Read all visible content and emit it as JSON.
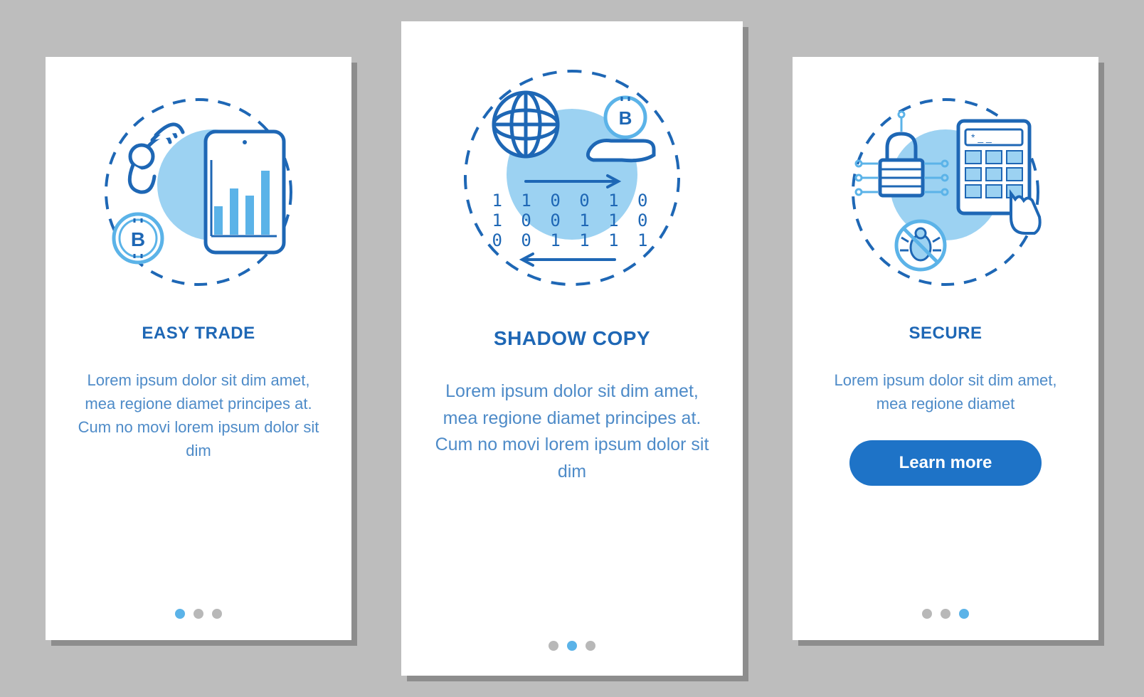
{
  "cards": [
    {
      "title": "Easy trade",
      "body": "Lorem ipsum dolor sit dim amet, mea regione diamet principes at. Cum no movi lorem ipsum dolor sit dim",
      "active_dot": 0,
      "cta": null
    },
    {
      "title": "Shadow copy",
      "body": "Lorem ipsum dolor sit dim amet, mea regione diamet principes at. Cum no movi lorem ipsum dolor sit dim",
      "active_dot": 1,
      "cta": null
    },
    {
      "title": "Secure",
      "body": "Lorem ipsum dolor sit dim amet, mea regione diamet",
      "active_dot": 2,
      "cta": "Learn more"
    }
  ],
  "colors": {
    "accent": "#1E73C7",
    "text_title": "#1E67B5",
    "text_body": "#4E8BC8",
    "dot_on": "#5BB3E8",
    "dot_off": "#B8B8B8"
  },
  "illustrations": {
    "binary_rows": [
      "1 1 0 0 1 0",
      "1 0 0 1 1 0",
      "0 0 1 1 1 1"
    ]
  }
}
